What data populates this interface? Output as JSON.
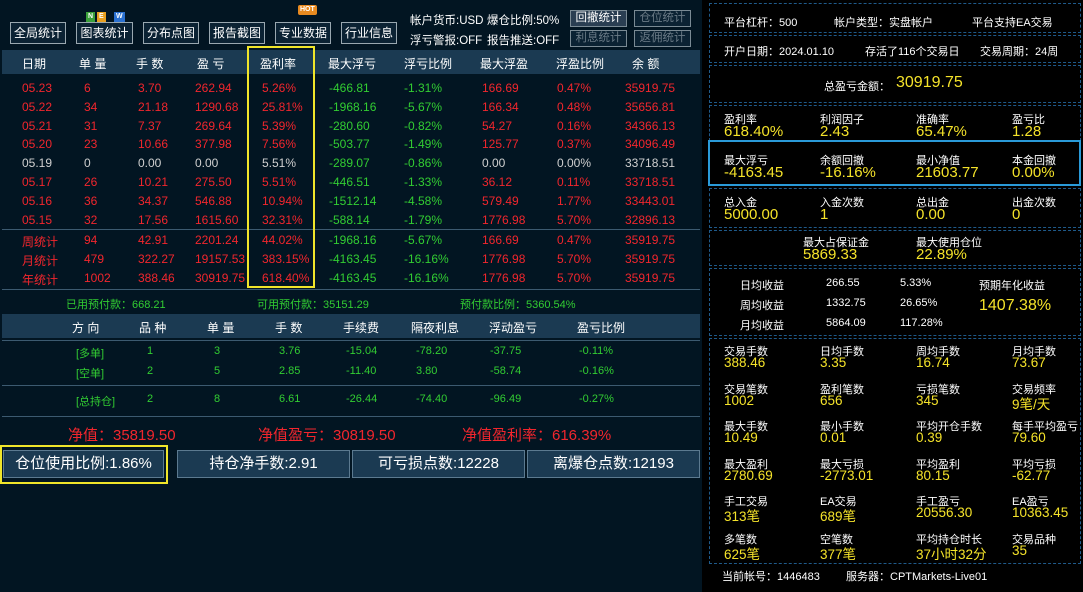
{
  "toolbar": {
    "overall": "全局统计",
    "chart": "图表统计",
    "scatter": "分布点图",
    "screenshot": "报告截图",
    "pro": "专业数据",
    "industry": "行业信息",
    "new_badge": "NEW",
    "hot_badge": "HOT"
  },
  "topinfo": {
    "currency": "帐户货币:USD",
    "burst": "爆仓比例:50%",
    "alert": "浮亏警报:OFF",
    "push": "报告推送:OFF",
    "drawdown": "回撤统计",
    "position": "仓位统计",
    "interest": "利息统计",
    "rebate": "返佣统计"
  },
  "columns": [
    "日期",
    "单 量",
    "手 数",
    "盈 亏",
    "盈利率",
    "最大浮亏",
    "浮亏比例",
    "最大浮盈",
    "浮盈比例",
    "余 额"
  ],
  "daily": [
    [
      "05.23",
      "6",
      "3.70",
      "262.94",
      "5.26%",
      "-466.81",
      "-1.31%",
      "166.69",
      "0.47%",
      "35919.75"
    ],
    [
      "05.22",
      "34",
      "21.18",
      "1290.68",
      "25.81%",
      "-1968.16",
      "-5.67%",
      "166.34",
      "0.48%",
      "35656.81"
    ],
    [
      "05.21",
      "31",
      "7.37",
      "269.64",
      "5.39%",
      "-280.60",
      "-0.82%",
      "54.27",
      "0.16%",
      "34366.13"
    ],
    [
      "05.20",
      "23",
      "10.66",
      "377.98",
      "7.56%",
      "-503.77",
      "-1.49%",
      "125.77",
      "0.37%",
      "34096.49"
    ],
    [
      "05.19",
      "0",
      "0.00",
      "0.00",
      "5.51%",
      "-289.07",
      "-0.86%",
      "0.00",
      "0.00%",
      "33718.51"
    ],
    [
      "05.17",
      "26",
      "10.21",
      "275.50",
      "5.51%",
      "-446.51",
      "-1.33%",
      "36.12",
      "0.11%",
      "33718.51"
    ],
    [
      "05.16",
      "36",
      "34.37",
      "546.88",
      "10.94%",
      "-1512.14",
      "-4.58%",
      "579.49",
      "1.77%",
      "33443.01"
    ],
    [
      "05.15",
      "32",
      "17.56",
      "1615.60",
      "32.31%",
      "-588.14",
      "-1.79%",
      "1776.98",
      "5.70%",
      "32896.13"
    ]
  ],
  "stats": [
    [
      "周统计",
      "94",
      "42.91",
      "2201.24",
      "44.02%",
      "-1968.16",
      "-5.67%",
      "166.69",
      "0.47%",
      "35919.75"
    ],
    [
      "月统计",
      "479",
      "322.27",
      "19157.53",
      "383.15%",
      "-4163.45",
      "-16.16%",
      "1776.98",
      "5.70%",
      "35919.75"
    ],
    [
      "年统计",
      "1002",
      "388.46",
      "30919.75",
      "618.40%",
      "-4163.45",
      "-16.16%",
      "1776.98",
      "5.70%",
      "35919.75"
    ]
  ],
  "margin": {
    "used": "已用预付款：668.21",
    "avail": "可用预付款：35151.29",
    "ratio": "预付款比例：5360.54%"
  },
  "pos_columns": [
    "方 向",
    "品 种",
    "单 量",
    "手 数",
    "手续费",
    "隔夜利息",
    "浮动盈亏",
    "盈亏比例"
  ],
  "positions": [
    [
      "[多单]",
      "1",
      "3",
      "3.76",
      "-15.04",
      "-78.20",
      "-37.75",
      "-0.11%"
    ],
    [
      "[空单]",
      "2",
      "5",
      "2.85",
      "-11.40",
      "3.80",
      "-58.74",
      "-0.16%"
    ],
    [
      "[总持仓]",
      "2",
      "8",
      "6.61",
      "-26.44",
      "-74.40",
      "-96.49",
      "-0.27%"
    ]
  ],
  "net": {
    "equity": "净值：35819.50",
    "equity_pl": "净值盈亏：30819.50",
    "equity_rate": "净值盈利率：616.39%"
  },
  "bottom": {
    "usage": "仓位使用比例:1.86%",
    "net_lots": "持仓净手数:2.91",
    "loss_points": "可亏损点数:12228",
    "liq_points": "离爆仓点数:12193"
  },
  "right": {
    "leverage": "平台杠杆：500",
    "acct_type": "帐户类型：实盘帐户",
    "ea": "平台支持EA交易",
    "open_date": "开户日期：2024.01.10",
    "days": "存活了116个交易日",
    "cycle": "交易周期：24周",
    "total_pl_label": "总盈亏金额：",
    "total_pl": "30919.75",
    "g1": [
      [
        "盈利率",
        "618.40%"
      ],
      [
        "利润因子",
        "2.43"
      ],
      [
        "准确率",
        "65.47%"
      ],
      [
        "盈亏比",
        "1.28"
      ]
    ],
    "g2": [
      [
        "最大浮亏",
        "-4163.45"
      ],
      [
        "余额回撤",
        "-16.16%"
      ],
      [
        "最小净值",
        "21603.77"
      ],
      [
        "本金回撤",
        "0.00%"
      ]
    ],
    "g3": [
      [
        "总入金",
        "5000.00"
      ],
      [
        "入金次数",
        "1"
      ],
      [
        "总出金",
        "0.00"
      ],
      [
        "出金次数",
        "0"
      ]
    ],
    "g4": [
      [
        "最大占保证金",
        "5869.33"
      ],
      [
        "最大使用仓位",
        "22.89%"
      ]
    ],
    "income": [
      [
        "日均收益",
        "266.55",
        "5.33%"
      ],
      [
        "周均收益",
        "1332.75",
        "26.65%"
      ],
      [
        "月均收益",
        "5864.09",
        "117.28%"
      ]
    ],
    "annual_label": "预期年化收益",
    "annual": "1407.38%",
    "g5": [
      [
        "交易手数",
        "388.46"
      ],
      [
        "日均手数",
        "3.35"
      ],
      [
        "周均手数",
        "16.74"
      ],
      [
        "月均手数",
        "73.67"
      ],
      [
        "交易笔数",
        "1002"
      ],
      [
        "盈利笔数",
        "656"
      ],
      [
        "亏损笔数",
        "345"
      ],
      [
        "交易频率",
        "9笔/天"
      ],
      [
        "最大手数",
        "10.49"
      ],
      [
        "最小手数",
        "0.01"
      ],
      [
        "平均开仓手数",
        "0.39"
      ],
      [
        "每手平均盈亏",
        "79.60"
      ],
      [
        "最大盈利",
        "2780.69"
      ],
      [
        "最大亏损",
        "-2773.01"
      ],
      [
        "平均盈利",
        "80.15"
      ],
      [
        "平均亏损",
        "-62.77"
      ],
      [
        "手工交易",
        "313笔"
      ],
      [
        "EA交易",
        "689笔"
      ],
      [
        "手工盈亏",
        "20556.30"
      ],
      [
        "EA盈亏",
        "10363.45"
      ],
      [
        "多笔数",
        "625笔"
      ],
      [
        "空笔数",
        "377笔"
      ],
      [
        "平均持仓时长",
        "37小时32分"
      ],
      [
        "交易品种",
        "35"
      ]
    ],
    "account": "当前帐号：1446483",
    "server": "服务器：CPTMarkets-Live01"
  },
  "colors": {
    "bg": "#021522",
    "header": "#1b3a52",
    "red": "#f2262d",
    "green": "#32cd32",
    "yellow": "#f5e32a",
    "highlight": "#f0e52a",
    "blue_border": "#2a9ad8"
  }
}
